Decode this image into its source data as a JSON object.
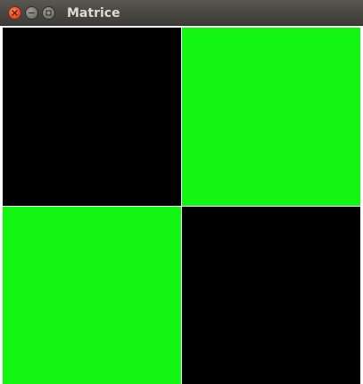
{
  "window": {
    "title": "Matrice"
  },
  "titlebar_buttons": [
    {
      "name": "close-button",
      "icon": "close-icon",
      "color": "#e8562a"
    },
    {
      "name": "minimize-button",
      "icon": "minimize-icon",
      "color": "#7a7974"
    },
    {
      "name": "maximize-button",
      "icon": "maximize-icon",
      "color": "#7a7974"
    }
  ],
  "matrix": {
    "rows": 2,
    "cols": 2,
    "cells": [
      [
        "#000000",
        "#12f612"
      ],
      [
        "#12f612",
        "#000000"
      ]
    ],
    "grid_line_color": "#ffffff"
  }
}
